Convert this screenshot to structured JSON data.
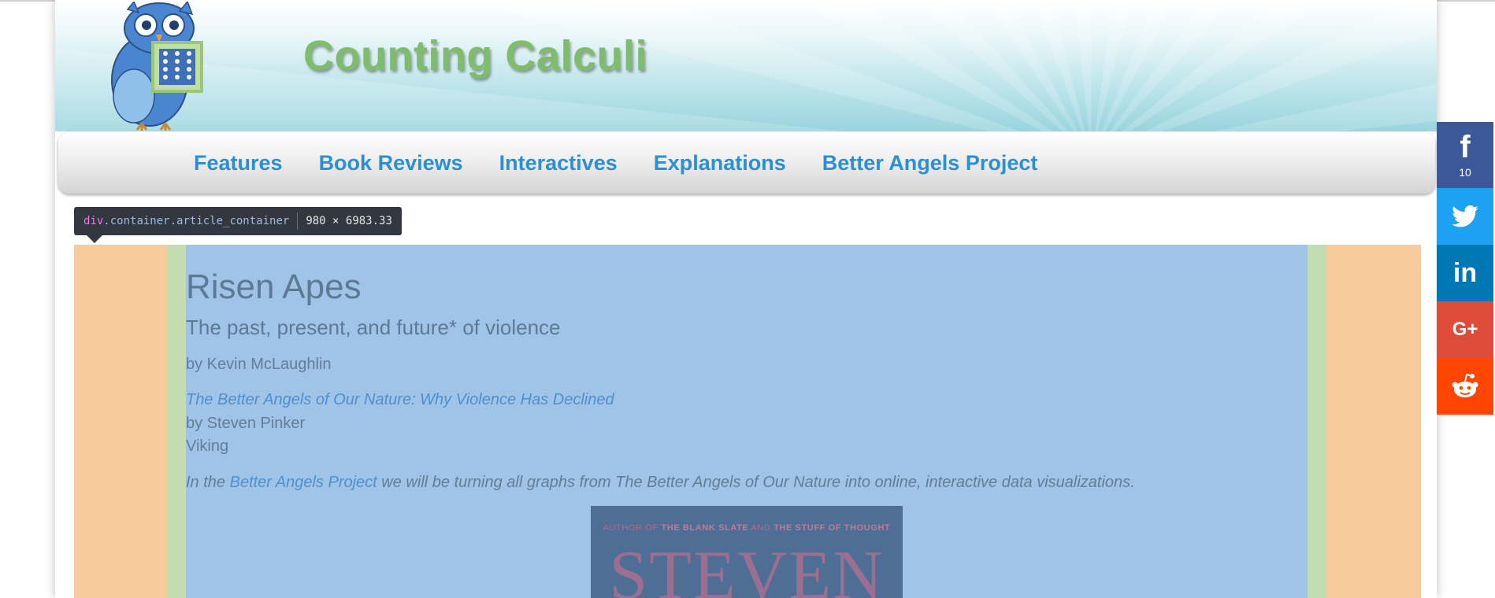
{
  "header": {
    "site_title": "Counting Calculi"
  },
  "nav": {
    "items": [
      {
        "label": "Features"
      },
      {
        "label": "Book Reviews"
      },
      {
        "label": "Interactives"
      },
      {
        "label": "Explanations"
      },
      {
        "label": "Better Angels Project"
      }
    ]
  },
  "devtools_tooltip": {
    "tag": "div",
    "classes": ".container.article_container",
    "dimensions": "980 × 6983.33"
  },
  "article": {
    "title": "Risen Apes",
    "subtitle": "The past, present, and future* of violence",
    "byline": "by Kevin McLaughlin",
    "book_title": "The Better Angels of Our Nature: Why Violence Has Declined",
    "book_author": "by Steven Pinker",
    "book_publisher": "Viking",
    "intro_prefix": "In the",
    "intro_link": "Better Angels Project",
    "intro_suffix": " we will be turning all graphs from The Better Angels of Our Nature into online, interactive data visualizations.",
    "cover": {
      "line_prefix": "AUTHOR OF",
      "line_book1": "THE BLANK SLATE",
      "line_and": "AND",
      "line_book2": "THE STUFF OF THOUGHT",
      "name": "STEVEN"
    }
  },
  "share": {
    "facebook_count": "10",
    "icons": [
      "facebook-icon",
      "twitter-icon",
      "linkedin-icon",
      "google-plus-icon",
      "reddit-icon"
    ],
    "colors": {
      "facebook": "#3b5998",
      "twitter": "#1da1f2",
      "linkedin": "#0077b5",
      "google_plus": "#dd4b39",
      "reddit": "#ff4500"
    }
  },
  "highlight_colors": {
    "margin": "#f7cb9b",
    "padding": "#c3ddb0",
    "content": "#a0c4e8"
  }
}
